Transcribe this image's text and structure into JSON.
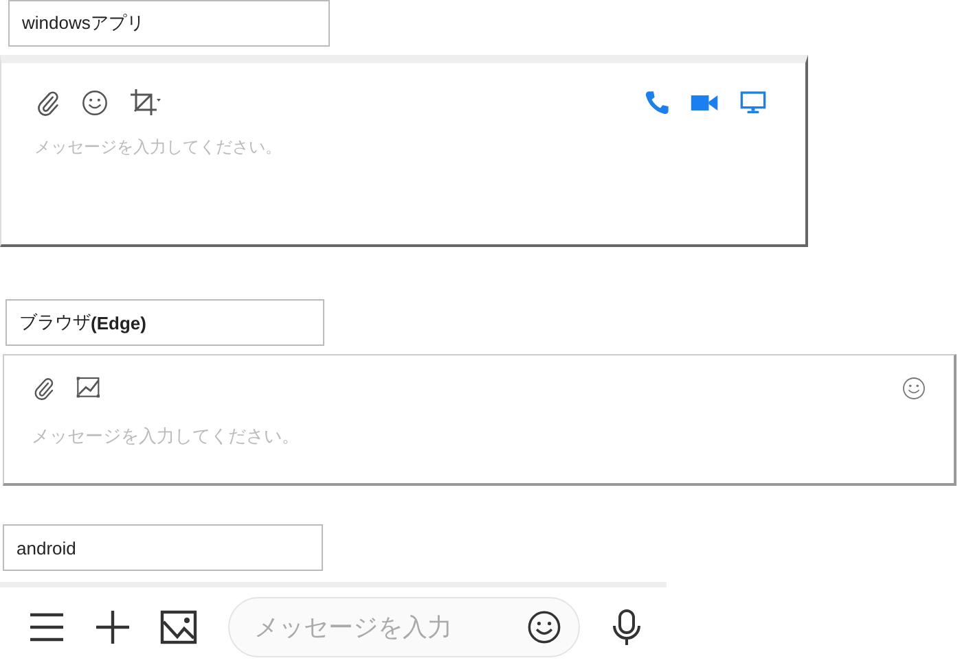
{
  "sections": [
    {
      "kind": "windows",
      "label": "windowsアプリ",
      "placeholder": "メッセージを入力してください。"
    },
    {
      "kind": "browser",
      "label": "ブラウザ**(Edge)**",
      "placeholder": "メッセージを入力してください。"
    },
    {
      "kind": "android",
      "label": "android",
      "placeholder": "メッセージを入力"
    }
  ]
}
